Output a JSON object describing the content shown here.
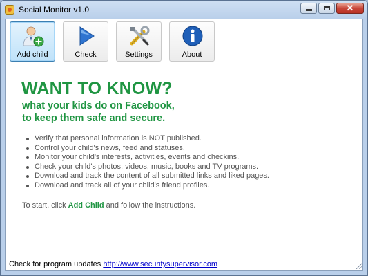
{
  "window": {
    "title": "Social Monitor v1.0"
  },
  "toolbar": {
    "buttons": [
      {
        "label": "Add child",
        "icon": "add-user-icon"
      },
      {
        "label": "Check",
        "icon": "play-icon"
      },
      {
        "label": "Settings",
        "icon": "tools-icon"
      },
      {
        "label": "About",
        "icon": "info-icon"
      }
    ]
  },
  "main": {
    "headline": "WANT TO KNOW?",
    "subline1": "what your kids do on Facebook,",
    "subline2": "to keep them safe and secure.",
    "features": [
      "Verify that personal information is NOT published.",
      "Control your child's news, feed and statuses.",
      "Monitor your child's interests, activities, events and checkins.",
      "Check your child's photos, videos, music, books and TV programs.",
      "Download and track the content of all submitted links and liked pages.",
      "Download and track all of your child's friend profiles."
    ],
    "start_prefix": "To start, click",
    "start_highlight": "Add Child",
    "start_suffix": "and follow the instructions."
  },
  "status": {
    "label": "Check for program updates",
    "link": "http://www.securitysupervisor.com"
  },
  "colors": {
    "accent_green": "#1f9542",
    "link_blue": "#0000cc",
    "active_button": "#bfe2fa"
  }
}
